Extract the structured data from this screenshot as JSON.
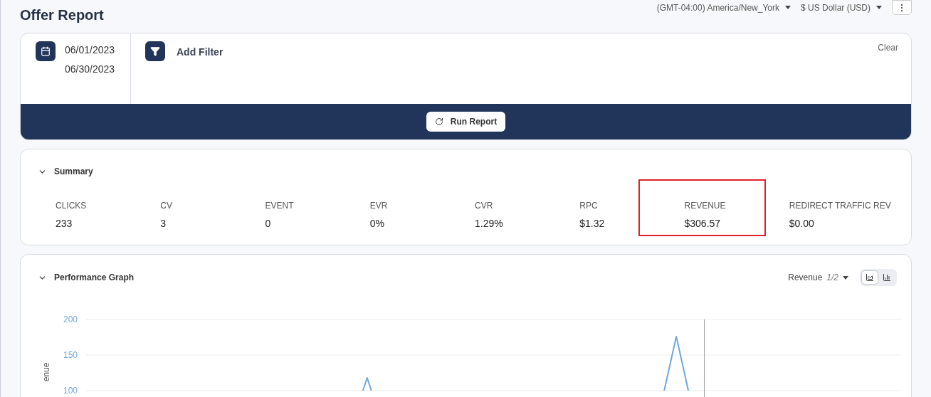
{
  "page": {
    "title": "Offer Report",
    "timezone": "(GMT-04:00) America/New_York",
    "currency": "$ US Dollar (USD)"
  },
  "filters": {
    "start_date": "06/01/2023",
    "end_date": "06/30/2023",
    "add_filter": "Add Filter",
    "clear": "Clear",
    "run_button": "Run Report"
  },
  "summary": {
    "title": "Summary",
    "expanded": true,
    "metrics": [
      {
        "label": "CLICKS",
        "value": "233",
        "highlighted": false
      },
      {
        "label": "CV",
        "value": "3",
        "highlighted": false
      },
      {
        "label": "EVENT",
        "value": "0",
        "highlighted": false
      },
      {
        "label": "EVR",
        "value": "0%",
        "highlighted": false
      },
      {
        "label": "CVR",
        "value": "1.29%",
        "highlighted": false
      },
      {
        "label": "RPC",
        "value": "$1.32",
        "highlighted": false
      },
      {
        "label": "REVENUE",
        "value": "$306.57",
        "highlighted": true
      },
      {
        "label": "REDIRECT TRAFFIC REV",
        "value": "$0.00",
        "highlighted": false
      }
    ]
  },
  "graph": {
    "title": "Performance Graph",
    "expanded": true,
    "metric_select": "Revenue",
    "metric_page": "1/2",
    "views": [
      {
        "kind": "line",
        "selected": true
      },
      {
        "kind": "bar",
        "selected": false
      }
    ],
    "y_axis_label": "enue",
    "y_ticks": [
      "200",
      "150",
      "100"
    ]
  }
}
